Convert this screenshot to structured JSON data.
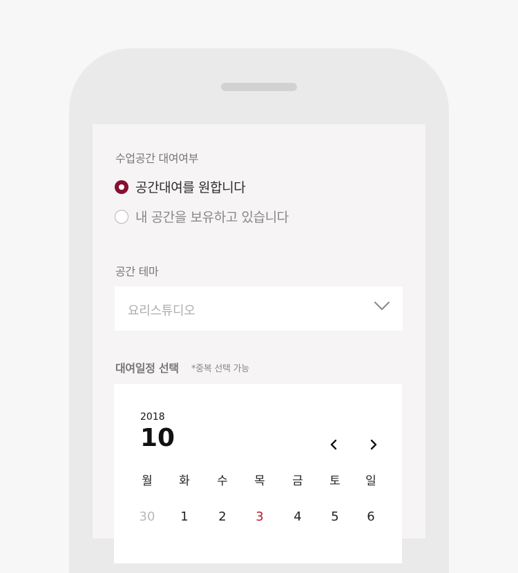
{
  "rental": {
    "label": "수업공간 대여여부",
    "options": [
      {
        "label": "공간대여를 원합니다",
        "selected": true
      },
      {
        "label": "내 공간을 보유하고 있습니다",
        "selected": false
      }
    ]
  },
  "theme": {
    "label": "공간 테마",
    "value": "요리스튜디오",
    "icon": "chevron-down-icon"
  },
  "schedule": {
    "title": "대여일정 선택",
    "note": "*중복 선택 가능"
  },
  "calendar": {
    "year": "2018",
    "month": "10",
    "prev_icon": "chevron-left-icon",
    "next_icon": "chevron-right-icon",
    "weekdays": [
      "월",
      "화",
      "수",
      "목",
      "금",
      "토",
      "일"
    ],
    "days": [
      {
        "label": "30",
        "state": "muted"
      },
      {
        "label": "1",
        "state": "normal"
      },
      {
        "label": "2",
        "state": "normal"
      },
      {
        "label": "3",
        "state": "holiday"
      },
      {
        "label": "4",
        "state": "normal"
      },
      {
        "label": "5",
        "state": "normal"
      },
      {
        "label": "6",
        "state": "normal"
      }
    ]
  },
  "colors": {
    "accent": "#86102f",
    "holiday": "#c0172d",
    "muted": "#b8b8b8"
  }
}
